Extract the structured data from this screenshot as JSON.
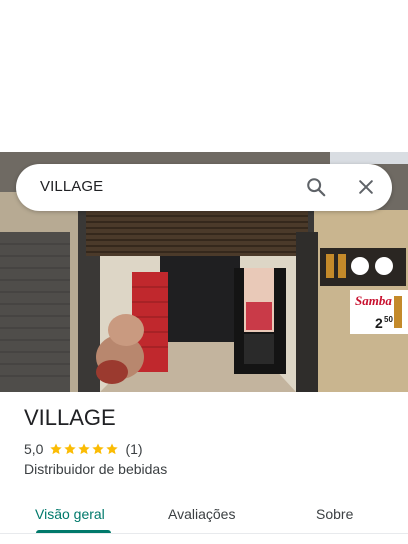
{
  "search": {
    "query": "VILLAGE"
  },
  "icons": {
    "search": "search-icon",
    "close": "close-icon",
    "star": "star-icon"
  },
  "photo": {
    "sign_brand": "Samba",
    "sign_price_main": "2",
    "sign_price_cents": "50"
  },
  "place": {
    "name": "VILLAGE",
    "rating_value": "5,0",
    "rating_stars": 5,
    "review_count": "(1)",
    "category": "Distribuidor de bebidas"
  },
  "tabs": [
    {
      "label": "Visão geral",
      "active": true
    },
    {
      "label": "Avaliações",
      "active": false
    },
    {
      "label": "Sobre",
      "active": false
    }
  ],
  "colors": {
    "accent": "#00796b",
    "star": "#fbbc04",
    "text_primary": "#202124",
    "text_secondary": "#3c4043"
  }
}
